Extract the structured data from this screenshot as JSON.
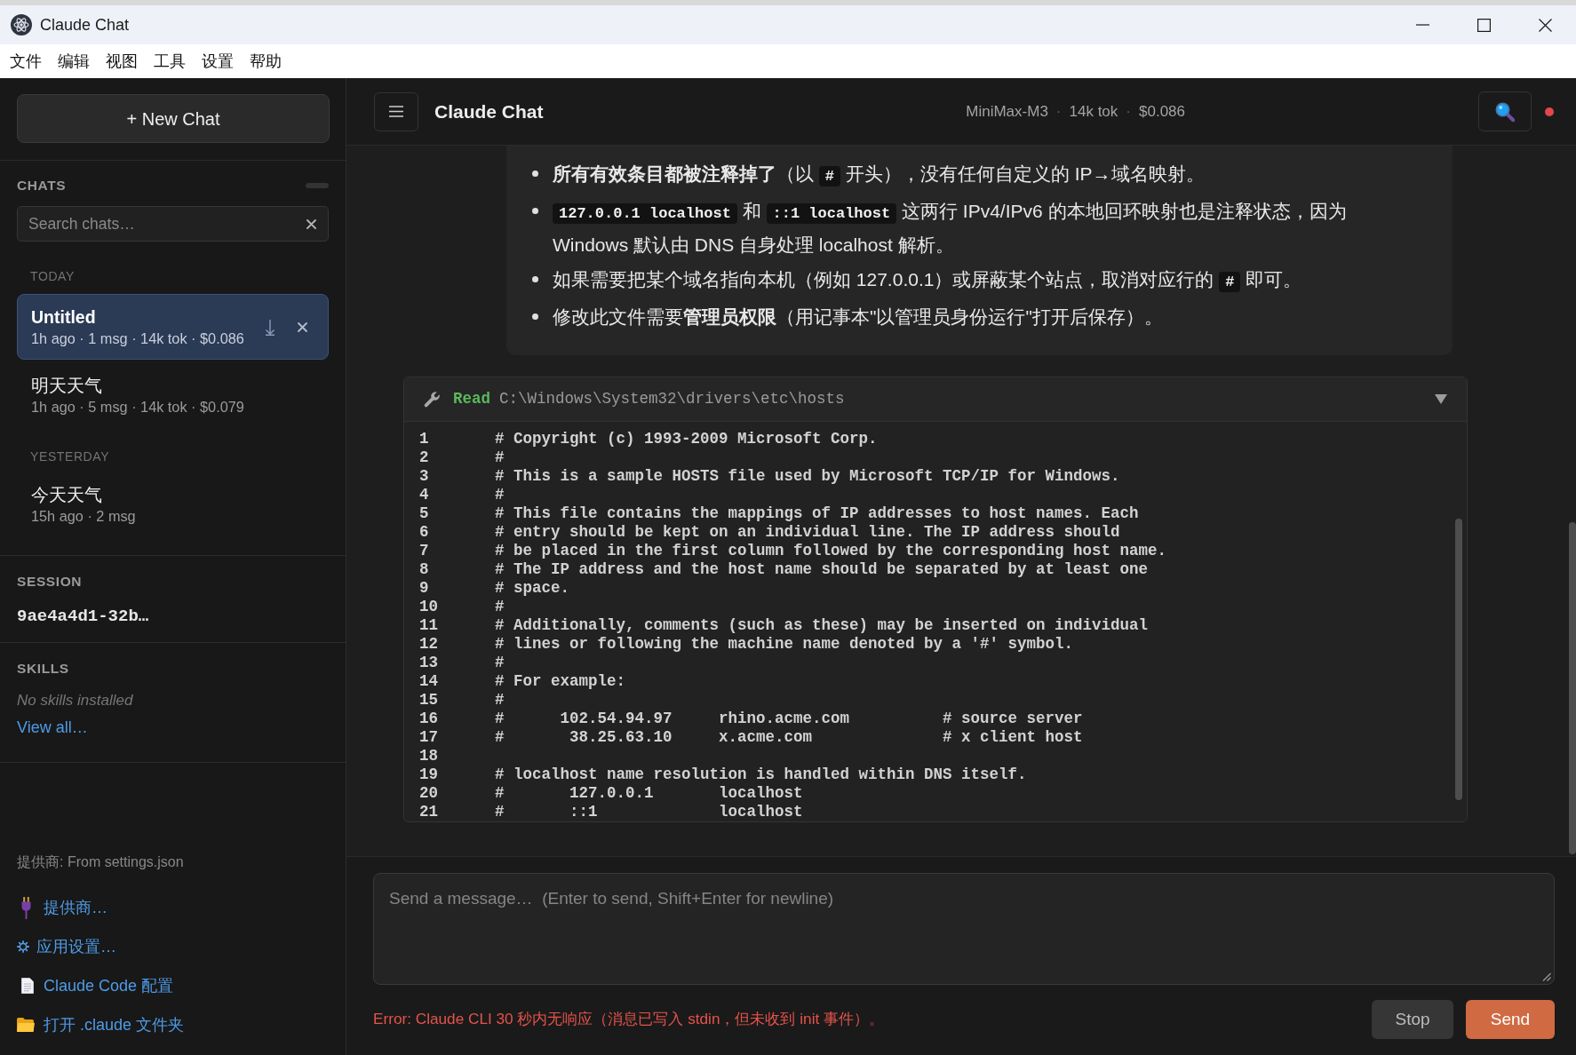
{
  "window": {
    "title": "Claude Chat"
  },
  "menu": [
    "文件",
    "编辑",
    "视图",
    "工具",
    "设置",
    "帮助"
  ],
  "sidebar": {
    "new_chat": "+ New Chat",
    "chats": {
      "heading": "CHATS",
      "search": {
        "placeholder": "Search chats…"
      },
      "groups": [
        {
          "label": "TODAY",
          "items": [
            {
              "title": "Untitled",
              "meta": "1h ago · 1 msg · 14k tok · $0.086",
              "selected": true
            },
            {
              "title": "明天天气",
              "meta": "1h ago · 5 msg · 14k tok · $0.079",
              "selected": false
            }
          ]
        },
        {
          "label": "YESTERDAY",
          "items": [
            {
              "title": "今天天气",
              "meta": "15h ago · 2 msg",
              "selected": false
            }
          ]
        }
      ]
    },
    "session": {
      "heading": "SESSION",
      "id": "9ae4a4d1-32b…"
    },
    "skills": {
      "heading": "SKILLS",
      "empty_text": "No skills installed",
      "link": "View all…"
    },
    "provider_note": "提供商: From settings.json",
    "links": [
      {
        "kind": "provider",
        "label": "提供商…"
      },
      {
        "kind": "settings",
        "label": "应用设置…"
      },
      {
        "kind": "config",
        "label": "Claude Code 配置"
      },
      {
        "kind": "folder",
        "label": "打开 .claude 文件夹"
      }
    ]
  },
  "header": {
    "title": "Claude Chat",
    "meta": [
      {
        "kind": "value",
        "text": "MiniMax-M3"
      },
      {
        "kind": "separator",
        "text": "·"
      },
      {
        "kind": "value",
        "text": "14k tok"
      },
      {
        "kind": "separator",
        "text": "·"
      },
      {
        "kind": "value",
        "text": "$0.086"
      }
    ]
  },
  "message": {
    "bullets": [
      [
        {
          "kind": "text",
          "text": "**所有有效条目都被注释掉了**（以 "
        },
        {
          "kind": "code",
          "text": "#"
        },
        {
          "kind": "text",
          "text": " 开头），没有任何自定义的 IP→域名映射。"
        }
      ],
      [
        {
          "kind": "code",
          "text": "127.0.0.1 localhost"
        },
        {
          "kind": "text",
          "text": " 和 "
        },
        {
          "kind": "code",
          "text": "::1 localhost"
        },
        {
          "kind": "text",
          "text": " 这两行 IPv4/IPv6 的本地回环映射也是注释状态，因为 Windows 默认由 DNS 自身处理 localhost 解析。"
        }
      ],
      [
        {
          "kind": "text",
          "text": "如果需要把某个域名指向本机（例如 127.0.0.1）或屏蔽某个站点，取消对应行的 "
        },
        {
          "kind": "code",
          "text": "#"
        },
        {
          "kind": "text",
          "text": " 即可。"
        }
      ],
      [
        {
          "kind": "text",
          "text": "修改此文件需要**管理员权限**（用记事本\"以管理员身份运行\"打开后保存）。"
        }
      ]
    ]
  },
  "tool_call": {
    "tool": "Read",
    "path": "C:\\Windows\\System32\\drivers\\etc\\hosts",
    "expanded": true,
    "lines": [
      {
        "number": "1",
        "text": "# Copyright (c) 1993-2009 Microsoft Corp."
      },
      {
        "number": "2",
        "text": "#"
      },
      {
        "number": "3",
        "text": "# This is a sample HOSTS file used by Microsoft TCP/IP for Windows."
      },
      {
        "number": "4",
        "text": "#"
      },
      {
        "number": "5",
        "text": "# This file contains the mappings of IP addresses to host names. Each"
      },
      {
        "number": "6",
        "text": "# entry should be kept on an individual line. The IP address should"
      },
      {
        "number": "7",
        "text": "# be placed in the first column followed by the corresponding host name."
      },
      {
        "number": "8",
        "text": "# The IP address and the host name should be separated by at least one"
      },
      {
        "number": "9",
        "text": "# space."
      },
      {
        "number": "10",
        "text": "#"
      },
      {
        "number": "11",
        "text": "# Additionally, comments (such as these) may be inserted on individual"
      },
      {
        "number": "12",
        "text": "# lines or following the machine name denoted by a '#' symbol."
      },
      {
        "number": "13",
        "text": "#"
      },
      {
        "number": "14",
        "text": "# For example:"
      },
      {
        "number": "15",
        "text": "#"
      },
      {
        "number": "16",
        "text": "#      102.54.94.97     rhino.acme.com          # source server"
      },
      {
        "number": "17",
        "text": "#       38.25.63.10     x.acme.com              # x client host"
      },
      {
        "number": "18"
      },
      {
        "number": "19",
        "text": "# localhost name resolution is handled within DNS itself."
      },
      {
        "number": "20",
        "text": "#       127.0.0.1       localhost"
      },
      {
        "number": "21",
        "text": "#       ::1             localhost"
      }
    ]
  },
  "composer": {
    "placeholder": "Send a message…  (Enter to send, Shift+Enter for newline)",
    "error": "Error: Claude CLI 30 秒内无响应（消息已写入 stdin，但未收到 init 事件）。",
    "buttons": [
      {
        "kind": "stop",
        "label": "Stop"
      },
      {
        "kind": "send",
        "label": "Send"
      }
    ]
  }
}
